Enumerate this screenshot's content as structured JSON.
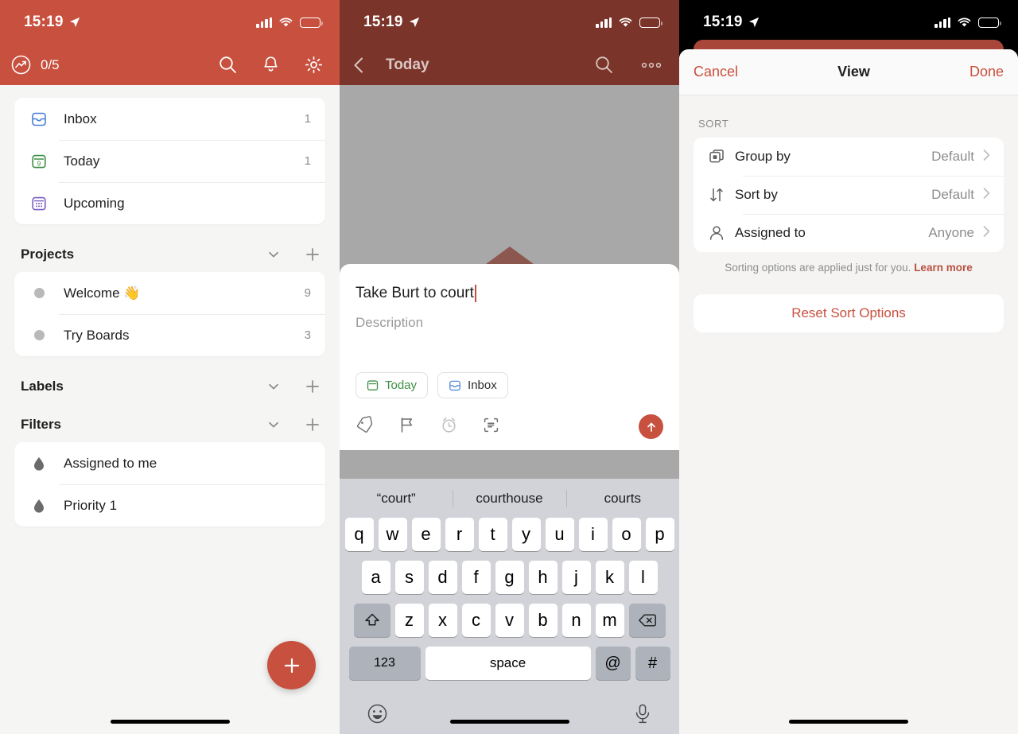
{
  "status_bar": {
    "time": "15:19",
    "location_icon": "location-arrow-icon",
    "signal_icon": "cellular-bars-icon",
    "wifi_icon": "wifi-icon",
    "battery_icon": "battery-icon"
  },
  "colors": {
    "brand_red": "#c8503e",
    "dimmed_red": "#7b3429",
    "peek_red": "#a9463a",
    "today_green": "#3c8f43",
    "inbox_blue": "#3b72c4",
    "upcoming_purple": "#7a5cc0",
    "panel_bg": "#f5f5f4",
    "keyboard_bg": "#d1d3d9"
  },
  "panel1": {
    "topbar": {
      "karma_count": "0/5",
      "karma_icon": "karma-trend-icon",
      "search_icon": "search-icon",
      "notifications_icon": "bell-icon",
      "settings_icon": "gear-icon"
    },
    "nav_items": [
      {
        "icon": "inbox-tray-icon",
        "label": "Inbox",
        "count": "1"
      },
      {
        "icon": "calendar-today-icon",
        "label": "Today",
        "count": "1"
      },
      {
        "icon": "calendar-upcoming-icon",
        "label": "Upcoming",
        "count": ""
      }
    ],
    "sections": [
      {
        "title": "Projects",
        "collapse_icon": "chevron-down-icon",
        "add_icon": "plus-icon",
        "items": [
          {
            "icon": "project-dot-icon",
            "label": "Welcome 👋",
            "count": "9"
          },
          {
            "icon": "project-dot-icon",
            "label": "Try Boards",
            "count": "3"
          }
        ]
      },
      {
        "title": "Labels",
        "collapse_icon": "chevron-down-icon",
        "add_icon": "plus-icon",
        "items": []
      },
      {
        "title": "Filters",
        "collapse_icon": "chevron-down-icon",
        "add_icon": "plus-icon",
        "items": [
          {
            "icon": "filter-drop-icon",
            "label": "Assigned to me",
            "count": ""
          },
          {
            "icon": "filter-drop-icon",
            "label": "Priority 1",
            "count": ""
          }
        ]
      }
    ],
    "fab": {
      "icon": "plus-icon",
      "label": "Add task"
    }
  },
  "panel2": {
    "topbar": {
      "back_icon": "chevron-left-icon",
      "title": "Today",
      "search_icon": "search-icon",
      "more_icon": "more-horizontal-icon"
    },
    "quick_add": {
      "task_name": "Take Burt to court",
      "description_placeholder": "Description",
      "chips": [
        {
          "icon": "calendar-today-icon",
          "label": "Today"
        },
        {
          "icon": "inbox-tray-icon",
          "label": "Inbox"
        }
      ],
      "tools": [
        {
          "icon": "label-tag-icon",
          "name": "labels"
        },
        {
          "icon": "priority-flag-icon",
          "name": "priority"
        },
        {
          "icon": "reminder-alarm-icon",
          "name": "reminder"
        },
        {
          "icon": "scan-text-icon",
          "name": "scan"
        }
      ],
      "send_icon": "arrow-up-icon"
    },
    "keyboard": {
      "suggestions": [
        "“court”",
        "courthouse",
        "courts"
      ],
      "row1": [
        "q",
        "w",
        "e",
        "r",
        "t",
        "y",
        "u",
        "i",
        "o",
        "p"
      ],
      "row2": [
        "a",
        "s",
        "d",
        "f",
        "g",
        "h",
        "j",
        "k",
        "l"
      ],
      "row3": [
        "z",
        "x",
        "c",
        "v",
        "b",
        "n",
        "m"
      ],
      "shift_icon": "shift-up-icon",
      "backspace_icon": "backspace-icon",
      "numbers_key": "123",
      "space_key": "space",
      "at_key": "@",
      "hash_key": "#",
      "emoji_icon": "emoji-smiley-icon",
      "mic_icon": "microphone-icon"
    }
  },
  "panel3": {
    "sheet_header": {
      "cancel": "Cancel",
      "title": "View",
      "done": "Done"
    },
    "section_label": "SORT",
    "options": [
      {
        "icon": "group-by-icon",
        "label": "Group by",
        "value": "Default",
        "chevron": "chevron-right-icon"
      },
      {
        "icon": "sort-arrows-icon",
        "label": "Sort by",
        "value": "Default",
        "chevron": "chevron-right-icon"
      },
      {
        "icon": "person-icon",
        "label": "Assigned to",
        "value": "Anyone",
        "chevron": "chevron-right-icon"
      }
    ],
    "note_text": "Sorting options are applied just for you.",
    "note_link": "Learn more",
    "reset_button": "Reset Sort Options"
  }
}
